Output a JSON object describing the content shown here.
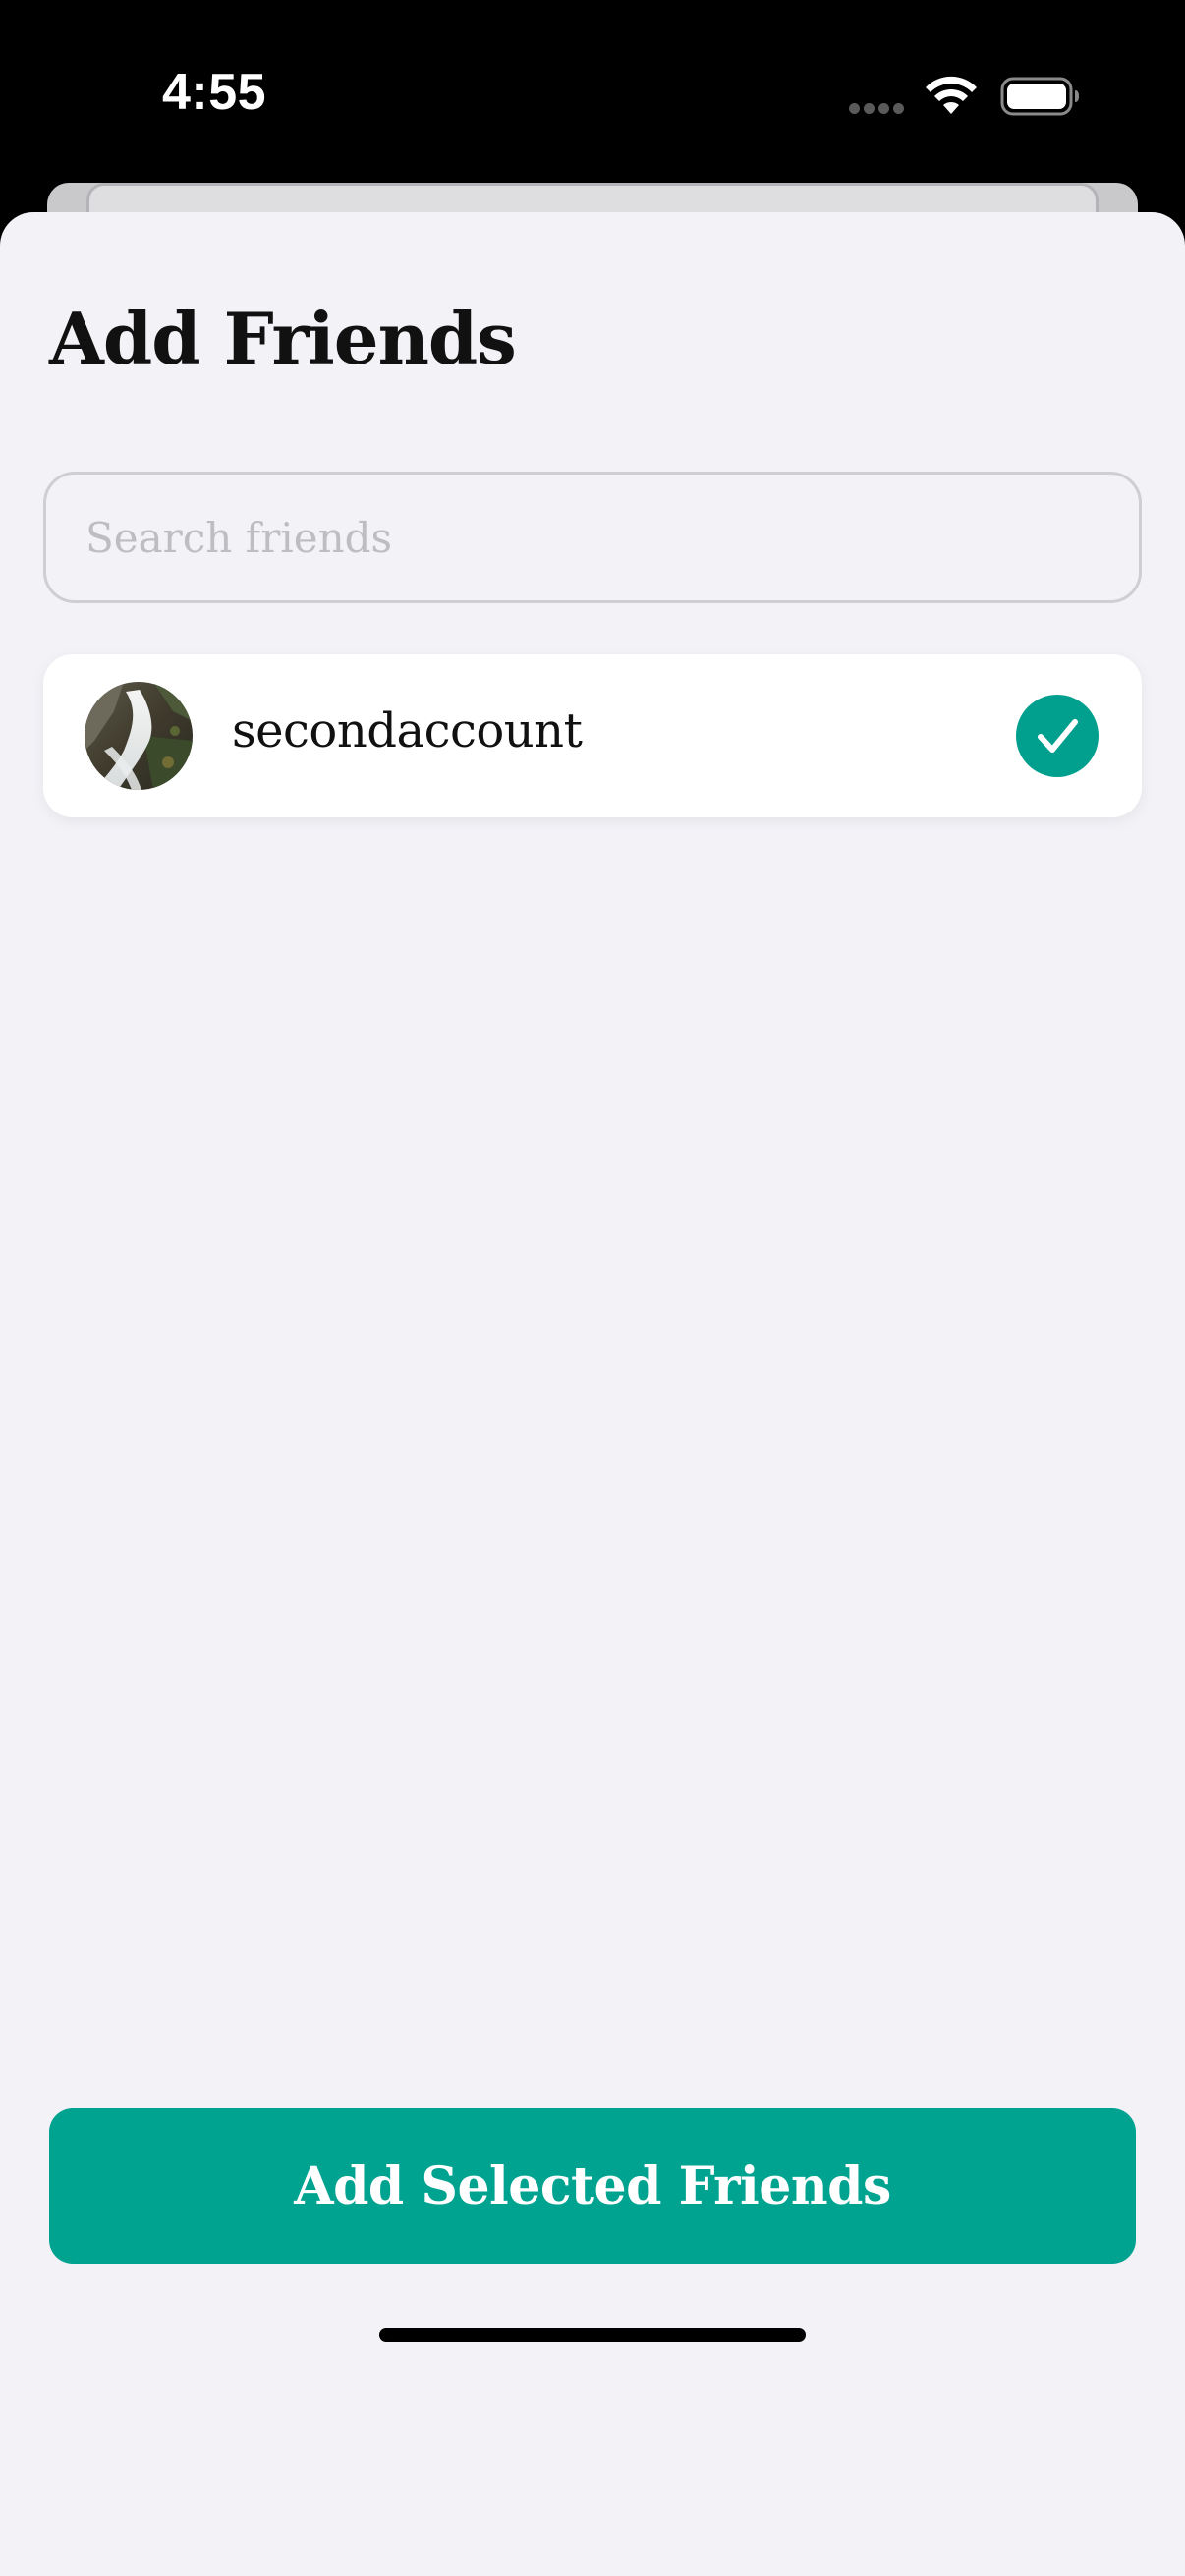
{
  "status_bar": {
    "time": "4:55",
    "signal_icon": "cellular-dots-icon",
    "wifi_icon": "wifi-icon",
    "battery_icon": "battery-full-icon"
  },
  "sheet": {
    "title": "Add Friends",
    "search": {
      "placeholder": "Search friends",
      "value": ""
    },
    "friends": [
      {
        "username": "secondaccount",
        "avatar": "waterfall-photo-avatar",
        "selected": true,
        "selected_icon": "checkmark-circle-icon"
      }
    ],
    "primary_button": "Add Selected Friends"
  },
  "colors": {
    "accent": "#00a390",
    "sheet_background": "#f2f2f7",
    "row_background": "#ffffff",
    "title_text": "#111111",
    "placeholder_text": "#bdbdc2"
  }
}
